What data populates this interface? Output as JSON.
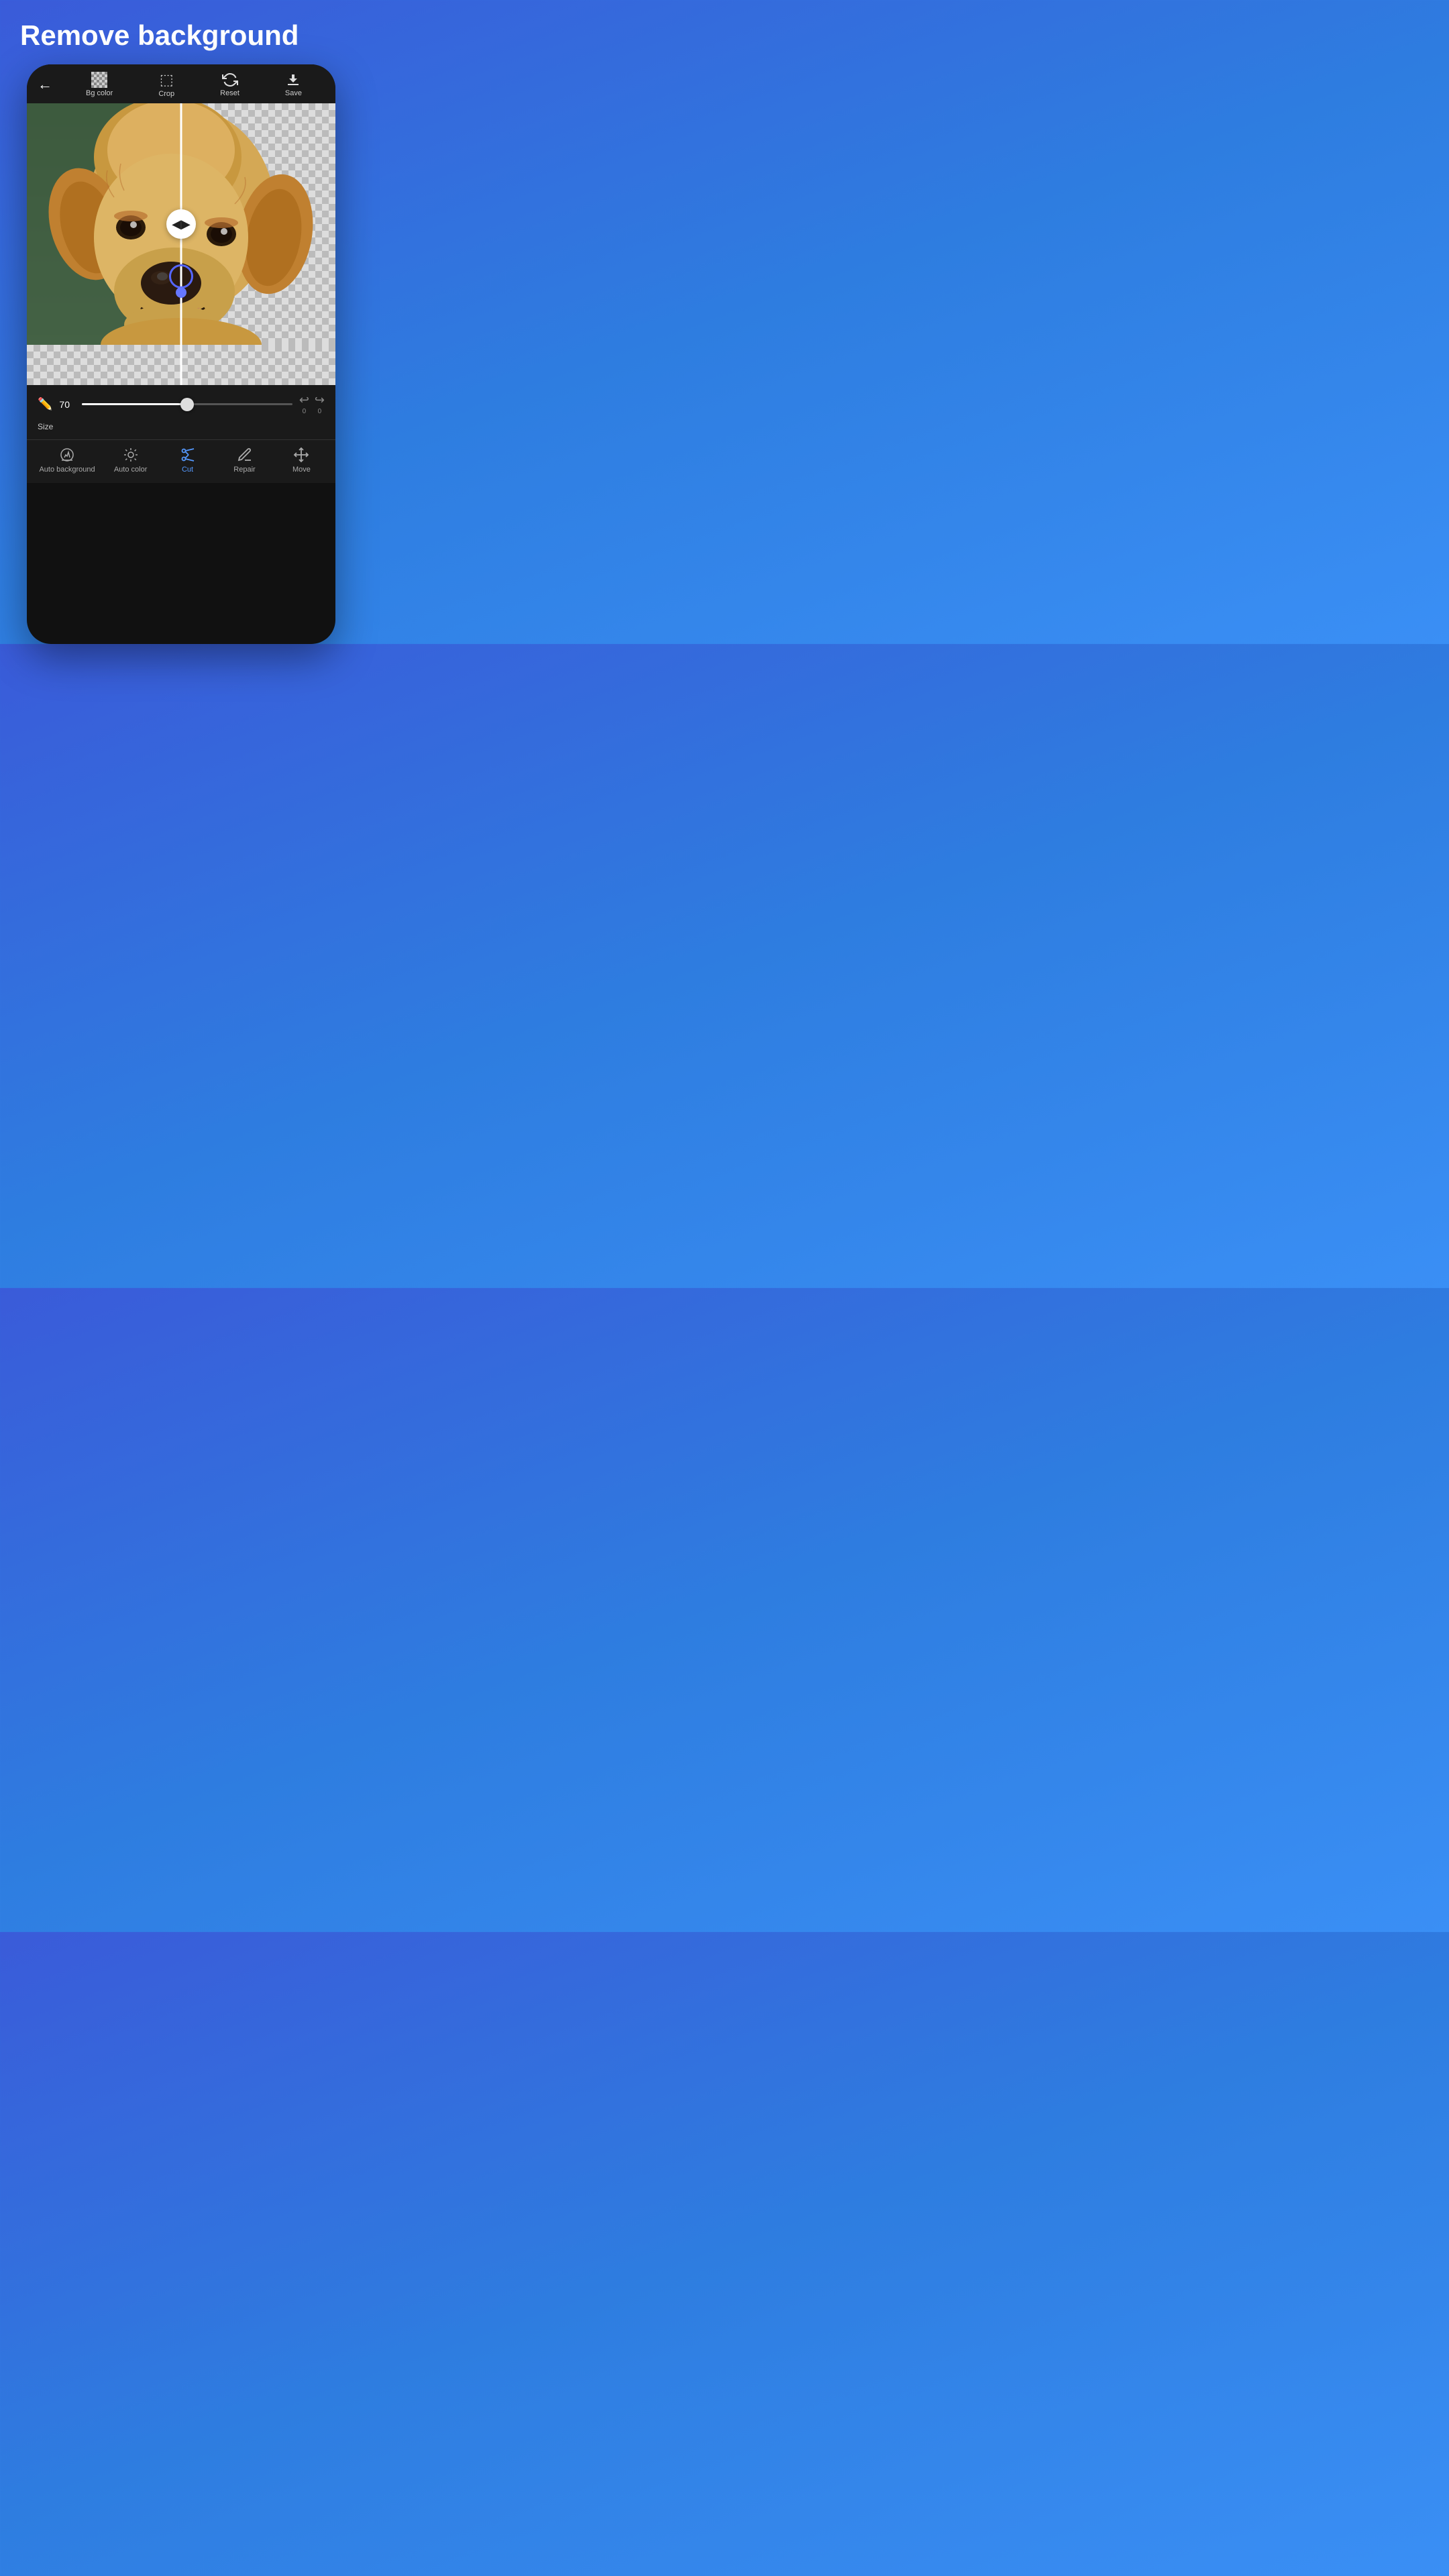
{
  "page": {
    "title": "Remove background",
    "background_gradient_start": "#3a5bd9",
    "background_gradient_end": "#3a8ff5"
  },
  "toolbar": {
    "back_label": "←",
    "bg_color_label": "Bg color",
    "crop_label": "Crop",
    "reset_label": "Reset",
    "save_label": "Save"
  },
  "size_control": {
    "label": "Size",
    "value": "70",
    "slider_percent": 50,
    "undo_count": "0",
    "redo_count": "0"
  },
  "bottom_tools": [
    {
      "id": "auto-background",
      "label": "Auto background",
      "active": false
    },
    {
      "id": "auto-color",
      "label": "Auto color",
      "active": false
    },
    {
      "id": "cut",
      "label": "Cut",
      "active": true
    },
    {
      "id": "repair",
      "label": "Repair",
      "active": false
    },
    {
      "id": "move",
      "label": "Move",
      "active": false
    }
  ]
}
